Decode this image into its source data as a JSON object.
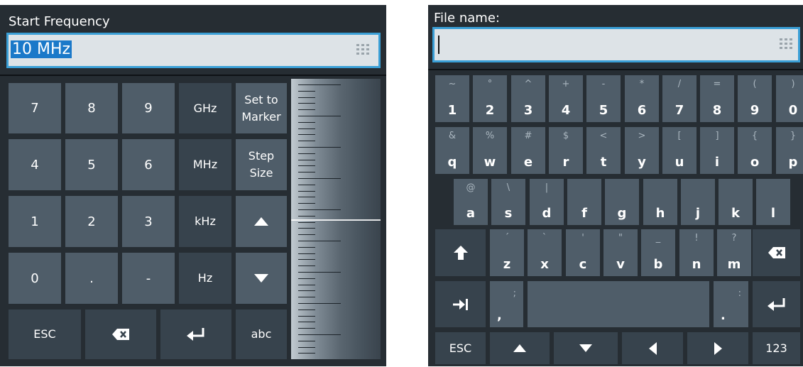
{
  "left": {
    "title": "Start Frequency",
    "field_value": "10 MHz",
    "keys": {
      "k7": "7",
      "k8": "8",
      "k9": "9",
      "ghz": "GHz",
      "set_to_marker_1": "Set to",
      "set_to_marker_2": "Marker",
      "k4": "4",
      "k5": "5",
      "k6": "6",
      "mhz": "MHz",
      "step_size_1": "Step",
      "step_size_2": "Size",
      "k1": "1",
      "k2": "2",
      "k3": "3",
      "khz": "kHz",
      "k0": "0",
      "dot": ".",
      "minus": "-",
      "hz": "Hz",
      "esc": "ESC",
      "abc": "abc"
    }
  },
  "right": {
    "title": "File name:",
    "field_value": "",
    "number_row": [
      {
        "sec": "~",
        "pri": "1"
      },
      {
        "sec": "°",
        "pri": "2"
      },
      {
        "sec": "^",
        "pri": "3"
      },
      {
        "sec": "+",
        "pri": "4"
      },
      {
        "sec": "-",
        "pri": "5"
      },
      {
        "sec": "*",
        "pri": "6"
      },
      {
        "sec": "/",
        "pri": "7"
      },
      {
        "sec": "=",
        "pri": "8"
      },
      {
        "sec": "(",
        "pri": "9"
      },
      {
        "sec": ")",
        "pri": "0"
      }
    ],
    "q_row": [
      {
        "sec": "&",
        "pri": "q"
      },
      {
        "sec": "%",
        "pri": "w"
      },
      {
        "sec": "#",
        "pri": "e"
      },
      {
        "sec": "$",
        "pri": "r"
      },
      {
        "sec": "<",
        "pri": "t"
      },
      {
        "sec": ">",
        "pri": "y"
      },
      {
        "sec": "[",
        "pri": "u"
      },
      {
        "sec": "]",
        "pri": "i"
      },
      {
        "sec": "{",
        "pri": "o"
      },
      {
        "sec": "}",
        "pri": "p"
      }
    ],
    "a_row": [
      {
        "sec": "@",
        "pri": "a"
      },
      {
        "sec": "\\",
        "pri": "s"
      },
      {
        "sec": "|",
        "pri": "d"
      },
      {
        "sec": "",
        "pri": "f"
      },
      {
        "sec": "",
        "pri": "g"
      },
      {
        "sec": "",
        "pri": "h"
      },
      {
        "sec": "",
        "pri": "j"
      },
      {
        "sec": "",
        "pri": "k"
      },
      {
        "sec": "",
        "pri": "l"
      }
    ],
    "z_row": [
      {
        "sec": "´",
        "pri": "z"
      },
      {
        "sec": "`",
        "pri": "x"
      },
      {
        "sec": "'",
        "pri": "c"
      },
      {
        "sec": "\"",
        "pri": "v"
      },
      {
        "sec": "_",
        "pri": "b"
      },
      {
        "sec": "!",
        "pri": "n"
      },
      {
        "sec": "?",
        "pri": "m"
      }
    ],
    "comma": {
      "sec": ";",
      "pri": ","
    },
    "period": {
      "sec": ":",
      "pri": "."
    },
    "esc": "ESC",
    "numeric": "123"
  },
  "colors": {
    "key_light": "#4f5d69",
    "key_dark": "#37434d",
    "background": "#262d33",
    "accent": "#3a9fd6"
  },
  "icons": [
    "grid-icon",
    "backspace-icon",
    "enter-icon",
    "arrow-up-icon",
    "arrow-down-icon",
    "shift-icon",
    "tab-icon",
    "arrow-left-icon",
    "arrow-right-icon"
  ]
}
